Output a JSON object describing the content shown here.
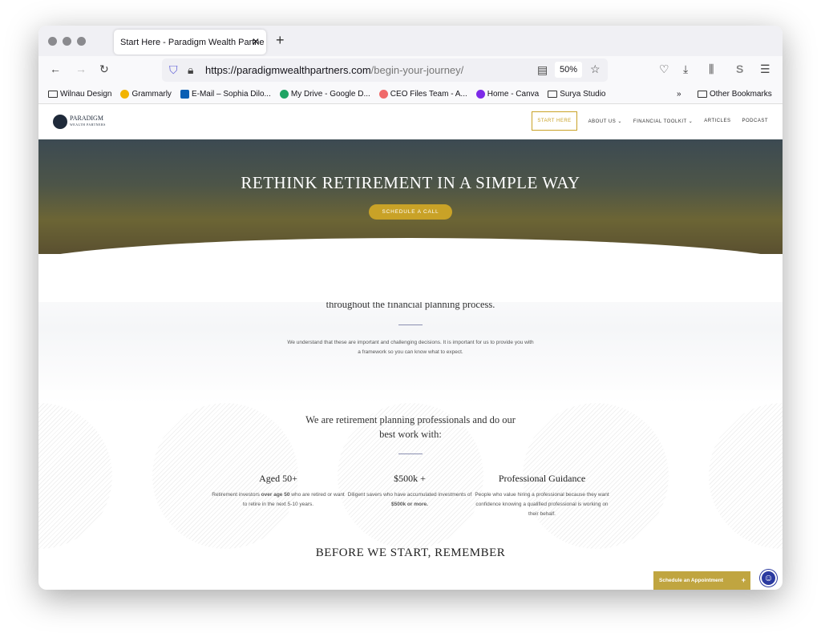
{
  "browser": {
    "tab_title": "Start Here - Paradigm Wealth Partne",
    "url_host": "https://paradigmwealthpartners.com",
    "url_path": "/begin-your-journey/",
    "zoom": "50%",
    "bookmarks": [
      "Wilnau Design",
      "Grammarly",
      "E-Mail – Sophia Dilo...",
      "My Drive - Google D...",
      "CEO Files Team - A...",
      "Home - Canva",
      "Surya Studio"
    ],
    "other_bookmarks": "Other Bookmarks"
  },
  "site": {
    "logo": {
      "name": "PARADIGM",
      "sub": "WEALTH PARTNERS"
    },
    "nav": [
      "START HERE",
      "ABOUT US ⌄",
      "FINANCIAL TOOLKIT ⌄",
      "ARTICLES",
      "PODCAST"
    ],
    "hero": {
      "title": "RETHINK RETIREMENT IN A SIMPLE WAY",
      "cta": "SCHEDULE A CALL"
    },
    "method": {
      "lead": "Our method is designed to give you confidence and clarity throughout the financial planning process.",
      "body": "We understand that these are important and challenging decisions. It is important for us to provide you with a framework so you can know what to expect."
    },
    "pros": {
      "heading": "We are retirement planning professionals and do our best work with:",
      "cols": [
        {
          "title": "Aged 50+",
          "pre": "Retirement investors ",
          "bold": "over age 50",
          "post": " who are retired or want to retire in the next 5-10 years."
        },
        {
          "title": "$500k +",
          "pre": "Diligent savers who have accumulated investments of ",
          "bold": "$500k or more.",
          "post": ""
        },
        {
          "title": "Professional Guidance",
          "pre": "People who value hiring a professional because they want confidence knowing a qualified professional is working on their behalf.",
          "bold": "",
          "post": ""
        }
      ]
    },
    "before": "BEFORE WE START, REMEMBER",
    "schedule": "Schedule an Appointment"
  },
  "colors": {
    "accent": "#c9a227",
    "navy": "#1f2a3a"
  }
}
